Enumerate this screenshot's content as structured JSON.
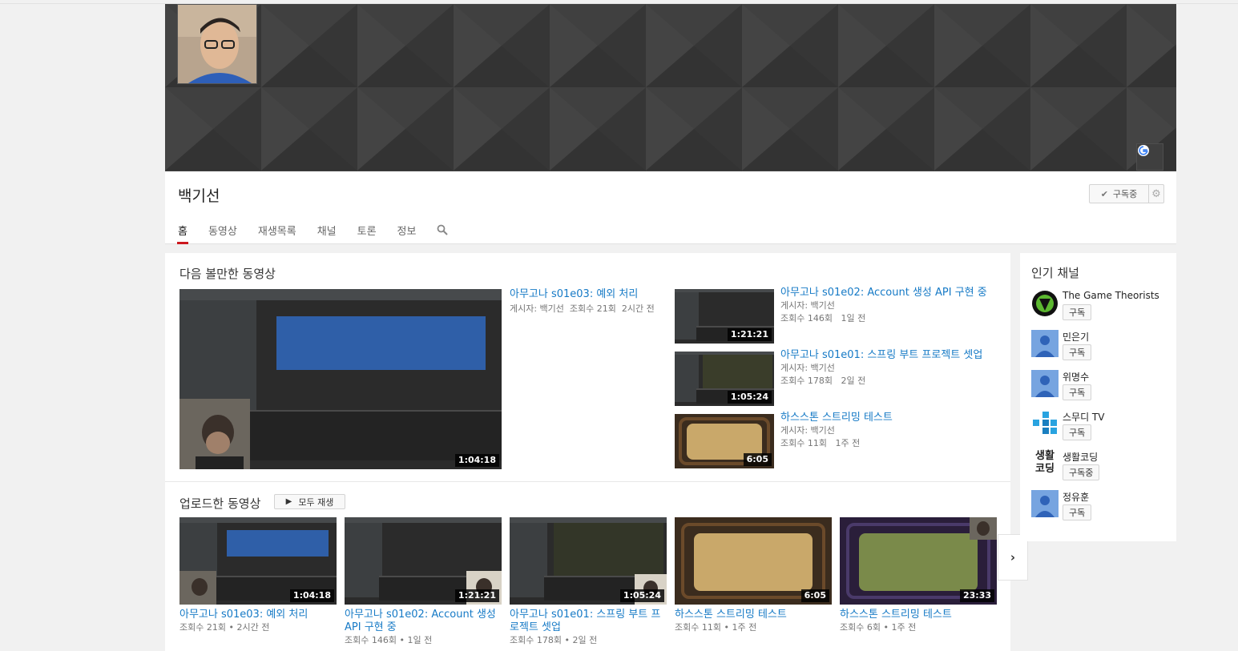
{
  "channel": {
    "name": "백기선",
    "subscribe_label": "구독중"
  },
  "tabs": [
    {
      "label": "홈"
    },
    {
      "label": "동영상"
    },
    {
      "label": "재생목록"
    },
    {
      "label": "채널"
    },
    {
      "label": "토론"
    },
    {
      "label": "정보"
    }
  ],
  "featured": {
    "section_title": "다음 볼만한 동영상",
    "main_video": {
      "title": "아무고나 s01e03: 예외 처리",
      "meta": "게시자: 백기선  조회수 21회  2시간 전",
      "duration": "1:04:18"
    },
    "list": [
      {
        "title": "아무고나 s01e02: Account 생성 API 구현 중",
        "by": "게시자: 백기선",
        "meta": "조회수 146회   1일 전",
        "duration": "1:21:21"
      },
      {
        "title": "아무고나 s01e01: 스프링 부트 프로젝트 셋업",
        "by": "게시자: 백기선",
        "meta": "조회수 178회   2일 전",
        "duration": "1:05:24"
      },
      {
        "title": "하스스톤 스트리밍 테스트",
        "by": "게시자: 백기선",
        "meta": "조회수 11회   1주 전",
        "duration": "6:05"
      }
    ]
  },
  "uploads": {
    "section_title": "업로드한 동영상",
    "play_all_label": "모두 재생",
    "videos": [
      {
        "title_line1": "아무고나 s01e03: 예외 처리",
        "title_line2": "",
        "meta": "조회수 21회 • 2시간 전",
        "duration": "1:04:18"
      },
      {
        "title_line1": "아무고나 s01e02: Account 생성",
        "title_line2": "API 구현 중",
        "meta": "조회수 146회 • 1일 전",
        "duration": "1:21:21"
      },
      {
        "title_line1": "아무고나 s01e01: 스프링 부트 프",
        "title_line2": "로젝트 셋업",
        "meta": "조회수 178회 • 2일 전",
        "duration": "1:05:24"
      },
      {
        "title_line1": "하스스톤 스트리밍 테스트",
        "title_line2": "",
        "meta": "조회수 11회 • 1주 전",
        "duration": "6:05"
      },
      {
        "title_line1": "하스스톤 스트리밍 테스트",
        "title_line2": "",
        "meta": "조회수 6회 • 1주 전",
        "duration": "23:33"
      }
    ]
  },
  "sidebar": {
    "title": "인기 채널",
    "channels": [
      {
        "name": "The Game Theorists",
        "button": "구독",
        "avatar_icon": "game-theorists-logo"
      },
      {
        "name": "민은기",
        "button": "구독",
        "avatar_icon": "default-person-icon"
      },
      {
        "name": "위명수",
        "button": "구독",
        "avatar_icon": "default-person-icon"
      },
      {
        "name": "스무디 TV",
        "button": "구독",
        "avatar_icon": "smoothie-tv-logo"
      },
      {
        "name": "생활코딩",
        "button": "구독중",
        "avatar_icon": "saenghwal-coding-logo",
        "logo_line1": "생활",
        "logo_line2": "코딩"
      },
      {
        "name": "정유훈",
        "button": "구독",
        "avatar_icon": "default-person-icon"
      }
    ]
  },
  "colors": {
    "link": "#167ac6",
    "tab_active": "#cc181e",
    "banner": "#3a3a3a"
  }
}
